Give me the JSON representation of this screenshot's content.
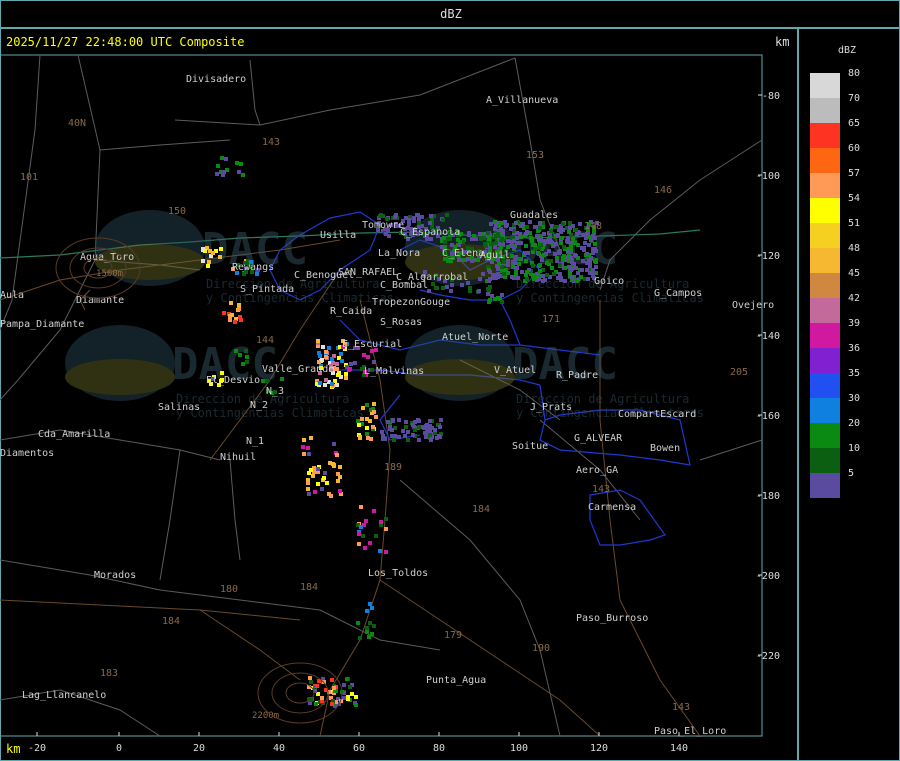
{
  "header": {
    "title": "dBZ"
  },
  "map": {
    "timestamp": "2025/11/27 22:48:00 UTC Composite",
    "unit_top": "km",
    "unit_bottom": "km",
    "x_ticks": [
      "-20",
      "0",
      "20",
      "40",
      "60",
      "80",
      "100",
      "120",
      "140"
    ],
    "y_ticks": [
      "-80",
      "-100",
      "-120",
      "-140",
      "-160",
      "-180",
      "-200",
      "-220"
    ],
    "places": [
      "Divisadero",
      "A_Villanueva",
      "Guadales",
      "Usilla",
      "Tomowre",
      "C_Espanola",
      "C_Elena",
      "Aguil",
      "Agua_Toro",
      "La_Nora",
      "C_Benoguel",
      "SAN_RAFAEL",
      "C_Algarrobal",
      "C_Bombal",
      "Goico",
      "G_Campos",
      "Ovejero",
      "Pampa_Diamante",
      "Rewangs",
      "S_Pintada",
      "R_Caida",
      "S_Rosas",
      "Tropezon",
      "Gouge",
      "Atuel_Norte",
      "E_Escurial",
      "Valle_Grande",
      "L_Malvinas",
      "V_Atuel",
      "R_Padre",
      "El_Desvio",
      "Salinas",
      "N_2",
      "N_1",
      "N_3",
      "Nihuil",
      "Cda_Amarilla",
      "J_Prats",
      "CompartEscard",
      "G_ALVEAR",
      "Soitue",
      "Bowen",
      "Aero_GA",
      "Carmensa",
      "Morados",
      "Los_Toldos",
      "Paso_Burroso",
      "Punta_Agua",
      "Lag_Llancanelo",
      "Paso_El_Loro",
      "Aula",
      "Diamante",
      "Diamentos"
    ],
    "route_numbers": [
      "143",
      "153",
      "146",
      "101",
      "150",
      "40N",
      "148",
      "171",
      "144",
      "189",
      "184",
      "180",
      "184",
      "179",
      "190",
      "183",
      "184",
      "143",
      "205",
      "143"
    ],
    "elevation_labels": [
      "1500m",
      "2200m"
    ],
    "watermarks": [
      {
        "brand": "DACC",
        "line1": "Direccion de Agricultura",
        "line2": "y Contingencias Climaticas"
      },
      {
        "brand": "DACC",
        "line1": "Direccion de Agricultura",
        "line2": "y Contingencias Climaticas"
      },
      {
        "brand": "DACC",
        "line1": "Direccion de Agricultura",
        "line2": "y Contingencias Climaticas"
      },
      {
        "brand": "DACC",
        "line1": "Direccion de Agricultura",
        "line2": "y Contingencias Climaticas"
      }
    ]
  },
  "legend": {
    "title": "dBZ",
    "levels": [
      {
        "value": "80",
        "color": "#d8d8d8"
      },
      {
        "value": "70",
        "color": "#bcbcbc"
      },
      {
        "value": "65",
        "color": "#ff3322"
      },
      {
        "value": "60",
        "color": "#ff6611"
      },
      {
        "value": "57",
        "color": "#ff9955"
      },
      {
        "value": "54",
        "color": "#ffff00"
      },
      {
        "value": "51",
        "color": "#f5d020"
      },
      {
        "value": "48",
        "color": "#f5b830"
      },
      {
        "value": "45",
        "color": "#d08840"
      },
      {
        "value": "42",
        "color": "#c46a9a"
      },
      {
        "value": "39",
        "color": "#d018a0"
      },
      {
        "value": "36",
        "color": "#8020d0"
      },
      {
        "value": "35",
        "color": "#2050f0"
      },
      {
        "value": "30",
        "color": "#1080e0"
      },
      {
        "value": "20",
        "color": "#0a8a10"
      },
      {
        "value": "10",
        "color": "#0a6010"
      },
      {
        "value": "5",
        "color": "#5a4aa0"
      }
    ]
  }
}
